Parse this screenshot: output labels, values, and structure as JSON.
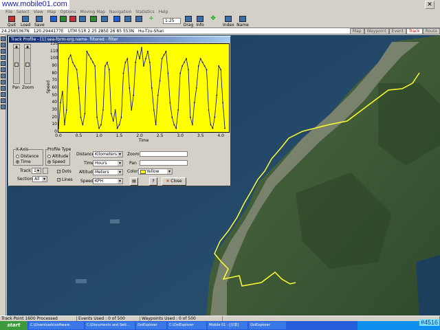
{
  "watermark": "www.mobile01.com",
  "menu": [
    "File",
    "Select",
    "View",
    "Map",
    "Options",
    "Moving Map",
    "Navigation",
    "Statistics",
    "Help"
  ],
  "toolbar": {
    "buttons": [
      {
        "label": "Quit",
        "icon": "quit-icon"
      },
      {
        "label": "Load",
        "icon": "open-folder-icon"
      },
      {
        "label": "Save",
        "icon": "save-icon"
      },
      {
        "label": "Index",
        "icon": "index-icon"
      },
      {
        "label": "Name",
        "icon": "name-icon"
      },
      {
        "label": "Drag",
        "icon": "drag-icon"
      },
      {
        "label": "Info",
        "icon": "info-icon"
      }
    ],
    "zoom_value": "1:25"
  },
  "coords": {
    "latlon": "24.2585367N",
    "lon": "120.2944177E",
    "utm": "UTM 51R  2 25 285E  26 85 553N",
    "place": "Hu-Tzu-Shan"
  },
  "view_tabs": [
    {
      "label": "Map",
      "active": false
    },
    {
      "label": "Waypoint",
      "active": false
    },
    {
      "label": "Event",
      "active": false
    },
    {
      "label": "Track",
      "active": true
    },
    {
      "label": "Route",
      "active": false
    }
  ],
  "profile": {
    "title": "Track Profile - [1] sea-form-org.name- filtered - filter",
    "pan_label": "Pan",
    "zoom_label": "Zoom",
    "xaxis_group": "X-Axis",
    "xaxis_options": [
      "Distance",
      "Time"
    ],
    "xaxis_selected": "Time",
    "profile_group": "Profile Type",
    "profile_options": [
      "Altitude",
      "Speed"
    ],
    "profile_selected": "Speed",
    "track_label": "Track",
    "track_value": "1",
    "section_label": "Section",
    "section_value": "All",
    "dots_label": "Dots",
    "lines_label": "Lines",
    "distance_label": "Distance",
    "distance_value": "Kilometers",
    "time_label": "Time",
    "time_value": "Hours",
    "altitude_label": "Altitude",
    "altitude_value": "Meters",
    "speed_label": "Speed",
    "speed_value": "KPH",
    "zoom2_label": "Zoom",
    "pan2_label": "Pan",
    "color_label": "Color",
    "color_value": "Yellow",
    "close_label": "Close",
    "help_label": "?"
  },
  "chart_data": {
    "type": "line",
    "title": "",
    "xlabel": "Time",
    "ylabel": "Speed",
    "xlim": [
      0,
      4.2
    ],
    "ylim": [
      0,
      120
    ],
    "xticks": [
      "0.0",
      "0.5",
      "1.0",
      "1.5",
      "2.0",
      "2.5",
      "3.0",
      "3.5",
      "4.0"
    ],
    "yticks": [
      "0",
      "10",
      "20",
      "30",
      "40",
      "50",
      "60",
      "70",
      "80",
      "90",
      "100",
      "110",
      "120"
    ],
    "grid": false,
    "background": "#ffff00",
    "series": [
      {
        "color": "#000080",
        "x": [
          0.0,
          0.05,
          0.1,
          0.15,
          0.2,
          0.25,
          0.3,
          0.35,
          0.4,
          0.45,
          0.5,
          0.55,
          0.6,
          0.65,
          0.7,
          0.75,
          0.8,
          0.85,
          0.9,
          0.95,
          1.0,
          1.05,
          1.1,
          1.15,
          1.2,
          1.25,
          1.3,
          1.35,
          1.4,
          1.45,
          1.5,
          1.55,
          1.6,
          1.65,
          1.7,
          1.75,
          1.8,
          1.85,
          1.9,
          1.95,
          2.0,
          2.05,
          2.1,
          2.15,
          2.2,
          2.25,
          2.3,
          2.35,
          2.4,
          2.45,
          2.5,
          2.55,
          2.6,
          2.65,
          2.7,
          2.75,
          2.8,
          2.85,
          2.9,
          2.95,
          3.0,
          3.05,
          3.1,
          3.15,
          3.2,
          3.25,
          3.3,
          3.35,
          3.4,
          3.45,
          3.5,
          3.55,
          3.6,
          3.65,
          3.7,
          3.75,
          3.8,
          3.85,
          3.9,
          3.95,
          4.0,
          4.05,
          4.1
        ],
        "y": [
          5,
          40,
          55,
          10,
          30,
          100,
          105,
          95,
          90,
          85,
          60,
          20,
          10,
          25,
          110,
          105,
          100,
          95,
          90,
          20,
          5,
          10,
          30,
          90,
          95,
          85,
          25,
          15,
          30,
          5,
          10,
          20,
          80,
          95,
          100,
          60,
          30,
          50,
          95,
          110,
          100,
          115,
          90,
          100,
          110,
          95,
          60,
          30,
          10,
          50,
          70,
          100,
          105,
          110,
          80,
          40,
          20,
          10,
          5,
          30,
          80,
          90,
          95,
          100,
          85,
          20,
          10,
          40,
          60,
          90,
          100,
          95,
          90,
          85,
          30,
          10,
          5,
          20,
          50,
          90,
          85,
          40,
          5
        ]
      }
    ]
  },
  "status": {
    "track_point": "Track Point 1600 Processed",
    "events": "Events Used : 0 of 500",
    "waypoints": "Waypoints Used : 0 of 500"
  },
  "taskbar": {
    "start": "start",
    "tasks": [
      "C:\\Downloads\\software",
      "C:\\Documents and Sett...",
      "OziExplorer",
      "C:\\OziExplorer",
      "Mobile 01 - [分享]",
      "OziExplorer"
    ],
    "tag": "#4516"
  }
}
